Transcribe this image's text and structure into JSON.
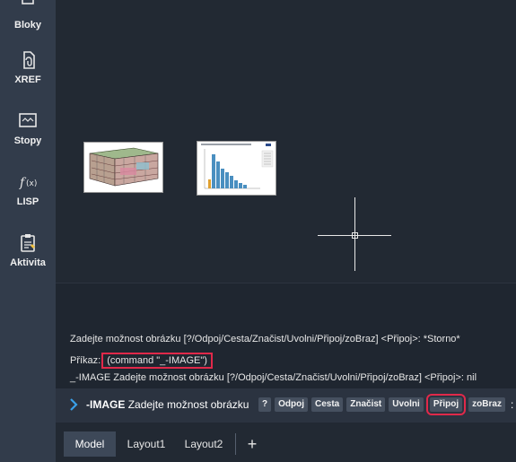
{
  "sidebar": {
    "items": [
      {
        "label": "Bloky",
        "icon": "blocks-icon"
      },
      {
        "label": "XREF",
        "icon": "xref-icon"
      },
      {
        "label": "Stopy",
        "icon": "traces-icon"
      },
      {
        "label": "LISP",
        "icon": "function-icon"
      },
      {
        "label": "Aktivita",
        "icon": "activity-icon"
      }
    ]
  },
  "history": {
    "line1": "Zadejte možnost obrázku [?/Odpoj/Cesta/Značist/Uvolni/Připoj/zoBraz] <Připoj>: *Storno*",
    "line2_prefix": "Příkaz:",
    "line2_command": "(command \"_-IMAGE\")",
    "line3": "_-IMAGE Zadejte možnost obrázku [?/Odpoj/Cesta/Značist/Uvolni/Připoj/zoBraz] <Připoj>: nil"
  },
  "cmdline": {
    "command": "-IMAGE",
    "prompt": "Zadejte možnost obrázku",
    "options": [
      "?",
      "Odpoj",
      "Cesta",
      "Značist",
      "Uvolni",
      "Připoj",
      "zoBraz"
    ],
    "highlighted_option": "Připoj",
    "suffix": ":"
  },
  "tabs": {
    "items": [
      "Model",
      "Layout1",
      "Layout2"
    ],
    "active": "Model",
    "add_label": "+"
  },
  "colors": {
    "accent_highlight": "#e0294a",
    "command_arrow": "#3aa0e8"
  }
}
